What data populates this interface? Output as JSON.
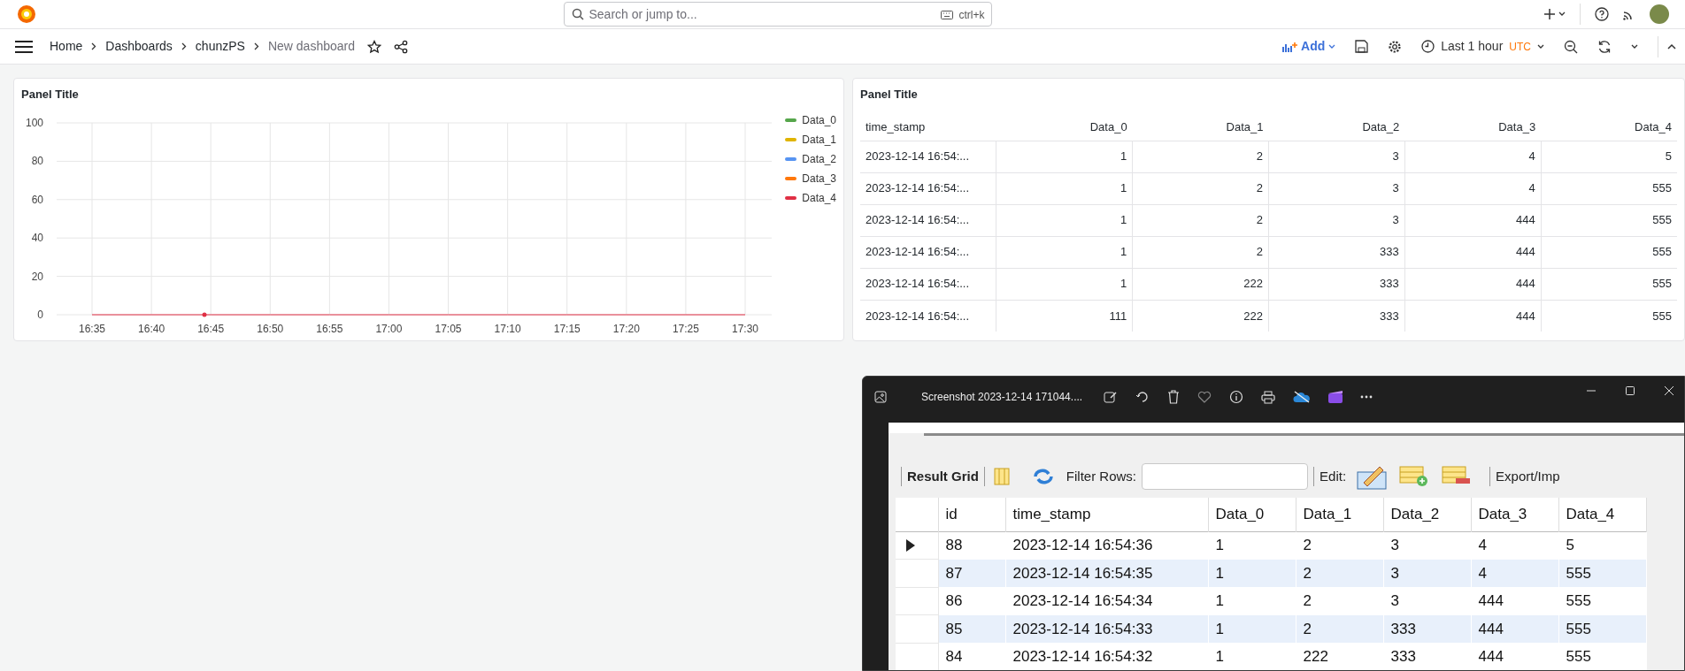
{
  "topbar": {
    "search": {
      "placeholder": "Search or jump to...",
      "shortcut": "ctrl+k"
    }
  },
  "breadcrumbs": [
    {
      "label": "Home",
      "current": false
    },
    {
      "label": "Dashboards",
      "current": false
    },
    {
      "label": "chunzPS",
      "current": false
    },
    {
      "label": "New dashboard",
      "current": true
    }
  ],
  "toolbar": {
    "add": "Add",
    "time_range": "Last 1 hour",
    "timezone": "UTC"
  },
  "panels": [
    {
      "kind": "timeseries",
      "title": "Panel Title",
      "chart_data": {
        "type": "line",
        "grid": true,
        "categories": [
          "16:35",
          "16:40",
          "16:45",
          "16:50",
          "16:55",
          "17:00",
          "17:05",
          "17:10",
          "17:15",
          "17:20",
          "17:25",
          "17:30"
        ],
        "ylim": [
          0,
          100
        ],
        "yticks": [
          0,
          20,
          40,
          60,
          80,
          100
        ],
        "series": [
          {
            "name": "Data_0",
            "color": "#56a64b",
            "values": [
              null,
              null,
              null,
              null,
              null,
              null,
              null,
              null,
              null,
              null,
              null,
              null
            ]
          },
          {
            "name": "Data_1",
            "color": "#e0b400",
            "values": [
              null,
              null,
              null,
              null,
              null,
              null,
              null,
              null,
              null,
              null,
              null,
              null
            ]
          },
          {
            "name": "Data_2",
            "color": "#5794f2",
            "values": [
              null,
              null,
              null,
              null,
              null,
              null,
              null,
              null,
              null,
              null,
              null,
              null
            ]
          },
          {
            "name": "Data_3",
            "color": "#ff780a",
            "values": [
              null,
              null,
              null,
              null,
              null,
              null,
              null,
              null,
              null,
              null,
              null,
              null
            ]
          },
          {
            "name": "Data_4",
            "color": "#e02f44",
            "values": [
              0,
              0,
              0,
              0,
              0,
              0,
              0,
              0,
              0,
              0,
              0,
              0
            ]
          }
        ]
      }
    },
    {
      "kind": "table",
      "title": "Panel Title",
      "columns": [
        "time_stamp",
        "Data_0",
        "Data_1",
        "Data_2",
        "Data_3",
        "Data_4"
      ],
      "rows": [
        [
          "2023-12-14 16:54:...",
          "1",
          "2",
          "3",
          "4",
          "5"
        ],
        [
          "2023-12-14 16:54:...",
          "1",
          "2",
          "3",
          "4",
          "555"
        ],
        [
          "2023-12-14 16:54:...",
          "1",
          "2",
          "3",
          "444",
          "555"
        ],
        [
          "2023-12-14 16:54:...",
          "1",
          "2",
          "333",
          "444",
          "555"
        ],
        [
          "2023-12-14 16:54:...",
          "1",
          "222",
          "333",
          "444",
          "555"
        ],
        [
          "2023-12-14 16:54:...",
          "111",
          "222",
          "333",
          "444",
          "555"
        ]
      ]
    }
  ],
  "viewer": {
    "title": "Screenshot 2023-12-14 171044....",
    "result_grid": {
      "label": "Result Grid",
      "filter_label": "Filter Rows:",
      "edit_label": "Edit:",
      "export_label": "Export/Imp",
      "columns": [
        "id",
        "time_stamp",
        "Data_0",
        "Data_1",
        "Data_2",
        "Data_3",
        "Data_4"
      ],
      "rows": [
        {
          "selected": true,
          "cells": [
            "88",
            "2023-12-14 16:54:36",
            "1",
            "2",
            "3",
            "4",
            "5"
          ]
        },
        {
          "selected": false,
          "cells": [
            "87",
            "2023-12-14 16:54:35",
            "1",
            "2",
            "3",
            "4",
            "555"
          ]
        },
        {
          "selected": false,
          "cells": [
            "86",
            "2023-12-14 16:54:34",
            "1",
            "2",
            "3",
            "444",
            "555"
          ]
        },
        {
          "selected": false,
          "cells": [
            "85",
            "2023-12-14 16:54:33",
            "1",
            "2",
            "333",
            "444",
            "555"
          ]
        },
        {
          "selected": false,
          "cells": [
            "84",
            "2023-12-14 16:54:32",
            "1",
            "222",
            "333",
            "444",
            "555"
          ]
        }
      ]
    }
  }
}
